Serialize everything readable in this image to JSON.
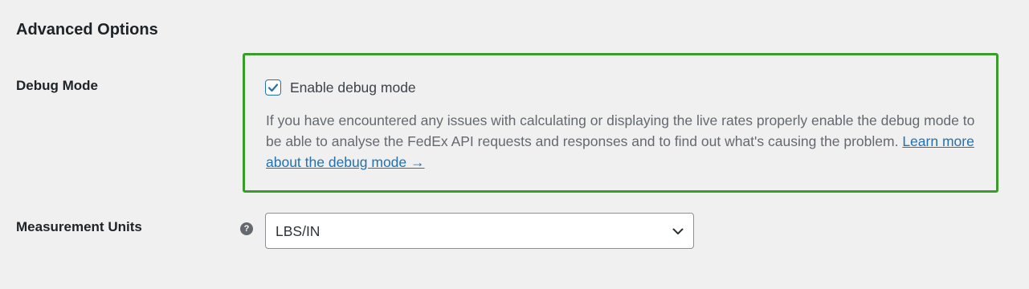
{
  "section": {
    "title": "Advanced Options"
  },
  "debug": {
    "label": "Debug Mode",
    "checkbox_label": "Enable debug mode",
    "checked": true,
    "description_text": "If you have encountered any issues with calculating or displaying the live rates properly enable the debug mode to be able to analyse the FedEx API requests and responses and to find out what's causing the problem.",
    "link_text": "Learn more about the debug mode →",
    "highlight_color": "#3a9d2b"
  },
  "units": {
    "label": "Measurement Units",
    "help_icon": "question-circle-icon",
    "selected": "LBS/IN"
  },
  "colors": {
    "background": "#f0f0f1",
    "link": "#2271b1",
    "checkbox_accent": "#2271b1"
  }
}
